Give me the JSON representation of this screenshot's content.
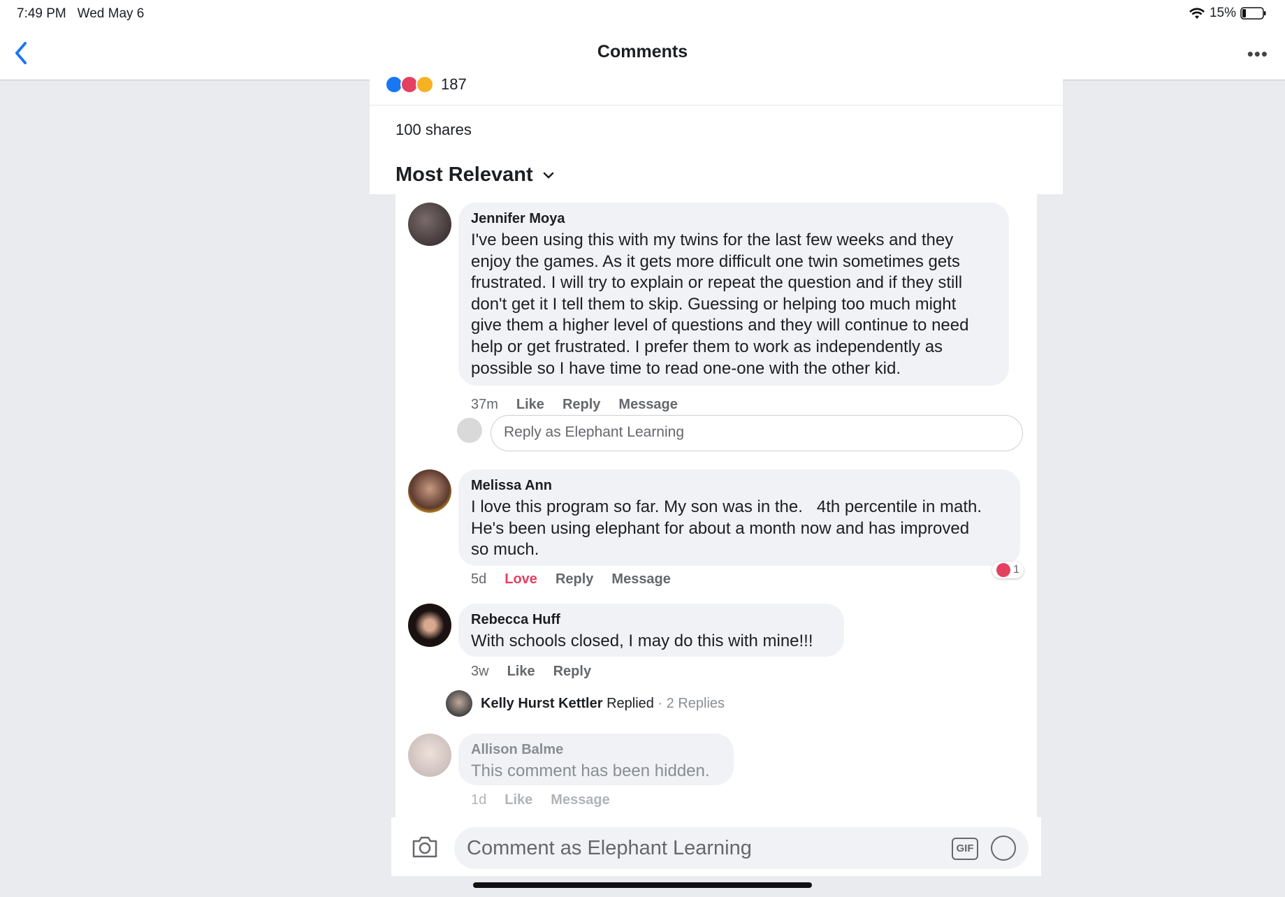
{
  "status": {
    "time": "7:49 PM",
    "date": "Wed May 6",
    "battery": "15%"
  },
  "nav": {
    "title": "Comments",
    "back_icon": "chevron-left-icon",
    "more": "•••"
  },
  "post": {
    "reaction_count": "187",
    "shares": "100 shares",
    "sort_label": "Most Relevant"
  },
  "comments": [
    {
      "author": "Jennifer Moya",
      "text": "I've been using this with my twins for the last few weeks and they\nenjoy the games. As it gets more difficult one twin sometimes gets\nfrustrated. I will try to explain or repeat the question and if they still\ndon't get it I tell them to skip. Guessing or helping too much might\ngive them a higher level of questions and they will continue to need\nhelp or get frustrated. I prefer them to work as independently as\npossible so I have time to read one-one with the other kid.",
      "time": "37m",
      "like": "Like",
      "reply": "Reply",
      "message": "Message"
    },
    {
      "author": "Melissa Ann",
      "text": "I love this program so far. My son was in the.   4th percentile in math.\nHe's been using elephant for about a month now and has improved\nso much.",
      "time": "5d",
      "like": "Love",
      "reply": "Reply",
      "message": "Message",
      "reaction_count": "1"
    },
    {
      "author": "Rebecca Huff",
      "text": "With schools closed, I may do this with mine!!!",
      "time": "3w",
      "like": "Like",
      "reply": "Reply"
    },
    {
      "author": "Allison Balme",
      "text": "This comment has been hidden.",
      "time": "1d",
      "like": "Like",
      "message": "Message"
    }
  ],
  "reply_box": {
    "placeholder": "Reply as Elephant Learning"
  },
  "replied": {
    "name": "Kelly Hurst Kettler",
    "verb": "Replied",
    "count": "· 2 Replies"
  },
  "composer": {
    "placeholder": "Comment as Elephant Learning",
    "gif": "GIF"
  },
  "colors": {
    "accent": "#1877f2",
    "love": "#e4405f",
    "bubble": "#f0f2f5"
  }
}
